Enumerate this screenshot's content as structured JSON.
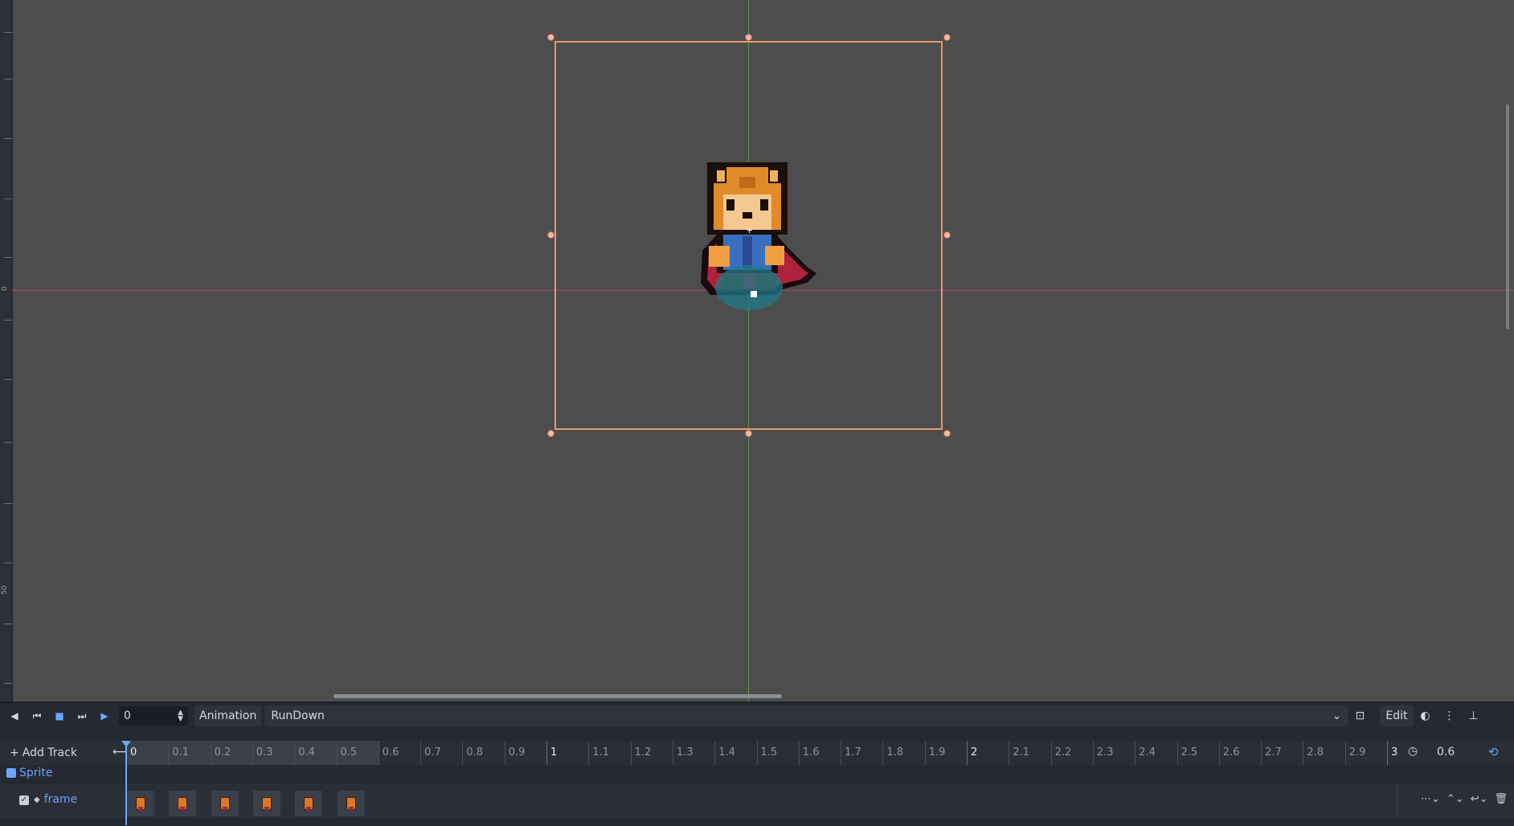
{
  "viewport": {
    "ruler_labels": [
      "0",
      "50"
    ]
  },
  "animation": {
    "time_value": "0",
    "label": "Animation",
    "current_animation": "RunDown",
    "edit_label": "Edit",
    "add_track_label": "Add Track",
    "length_value": "0.6",
    "timeline_ticks": [
      "0",
      "0.1",
      "0.2",
      "0.3",
      "0.4",
      "0.5",
      "0.6",
      "0.7",
      "0.8",
      "0.9",
      "1",
      "1.1",
      "1.2",
      "1.3",
      "1.4",
      "1.5",
      "1.6",
      "1.7",
      "1.8",
      "1.9",
      "2",
      "2.1",
      "2.2",
      "2.3",
      "2.4",
      "2.5",
      "2.6",
      "2.7",
      "2.8",
      "2.9",
      "3"
    ],
    "track_node": "Sprite",
    "track_property": "frame",
    "keyframe_count": 6
  },
  "colors": {
    "accent": "#6aa6ff",
    "selection": "#e99a6a",
    "x_axis": "#b44a5c",
    "y_axis": "#6a9a4a"
  }
}
